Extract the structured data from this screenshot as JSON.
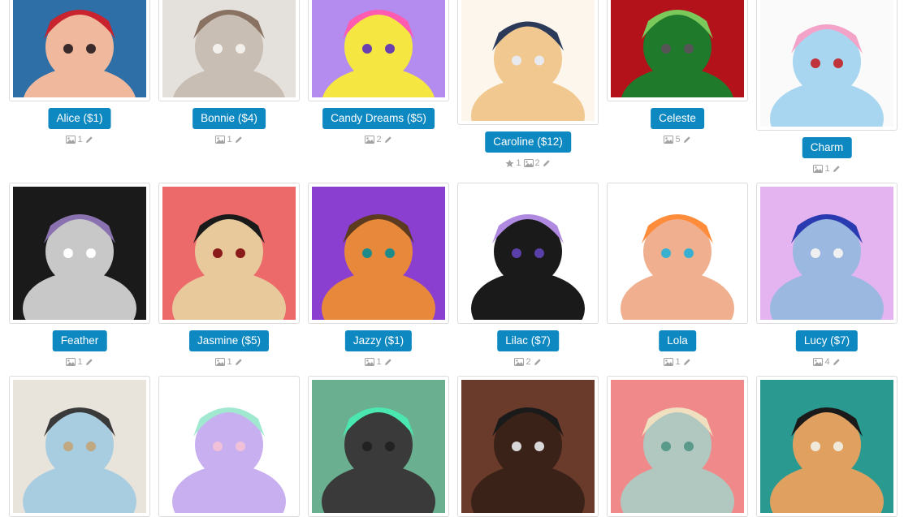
{
  "characters": [
    {
      "label": "Alice ($1)",
      "images": "1",
      "palette": [
        "#2e6fa8",
        "#f0b89c",
        "#c8232e",
        "#3a2a2a"
      ]
    },
    {
      "label": "Bonnie ($4)",
      "images": "1",
      "palette": [
        "#e4e0dc",
        "#c9beb3",
        "#8a7262",
        "#f3efeb"
      ]
    },
    {
      "label": "Candy Dreams ($5)",
      "images": "2",
      "palette": [
        "#b48cf0",
        "#f5e642",
        "#ff5bb0",
        "#6a3fb0"
      ]
    },
    {
      "label": "Caroline ($12)",
      "favorites": "1",
      "images": "2",
      "palette": [
        "#fdf6ec",
        "#f0c890",
        "#2c3a5a",
        "#e9e9f0"
      ]
    },
    {
      "label": "Celeste",
      "images": "5",
      "palette": [
        "#b3121b",
        "#1f7a2b",
        "#7ac95a",
        "#555555"
      ]
    },
    {
      "label": "Charm",
      "images": "1",
      "palette": [
        "#fafafa",
        "#a8d6f0",
        "#f4a3c8",
        "#c0333a"
      ]
    },
    {
      "label": "Feather",
      "images": "1",
      "palette": [
        "#1a1a1a",
        "#c8c8c8",
        "#8a72b0",
        "#ffffff"
      ]
    },
    {
      "label": "Jasmine ($5)",
      "images": "1",
      "palette": [
        "#ec6a6a",
        "#e8c99c",
        "#1a1a1a",
        "#8a1b1b"
      ]
    },
    {
      "label": "Jazzy ($1)",
      "images": "1",
      "palette": [
        "#8a3fd0",
        "#e8883a",
        "#5b3a1f",
        "#1e8a8a"
      ]
    },
    {
      "label": "Lilac ($7)",
      "images": "2",
      "palette": [
        "#ffffff",
        "#1a1a1a",
        "#b08ae0",
        "#5b3fa8"
      ]
    },
    {
      "label": "Lola",
      "images": "1",
      "palette": [
        "#ffffff",
        "#f0b090",
        "#ff8c3a",
        "#3ab0d0"
      ]
    },
    {
      "label": "Lucy ($7)",
      "images": "4",
      "palette": [
        "#e4b4f0",
        "#9ab8e0",
        "#2a3ab0",
        "#f0f0f0"
      ]
    },
    {
      "label": "",
      "images": "",
      "palette": [
        "#e8e4dc",
        "#a8cce0",
        "#3a3a3a",
        "#c0a880"
      ]
    },
    {
      "label": "",
      "images": "",
      "palette": [
        "#ffffff",
        "#c8b0f0",
        "#a0e8d0",
        "#f0c0d8"
      ]
    },
    {
      "label": "",
      "images": "",
      "palette": [
        "#6ab090",
        "#3a3a3a",
        "#4ae8b0",
        "#222222"
      ]
    },
    {
      "label": "",
      "images": "",
      "palette": [
        "#6a3a2a",
        "#3a2218",
        "#1a1a1a",
        "#d8d8d8"
      ]
    },
    {
      "label": "",
      "images": "",
      "palette": [
        "#f08a8a",
        "#b0c8c0",
        "#f0e0c0",
        "#5a9a8a"
      ]
    },
    {
      "label": "",
      "images": "",
      "palette": [
        "#2a9a90",
        "#e0a060",
        "#1a1a1a",
        "#f0e8d8"
      ]
    }
  ]
}
